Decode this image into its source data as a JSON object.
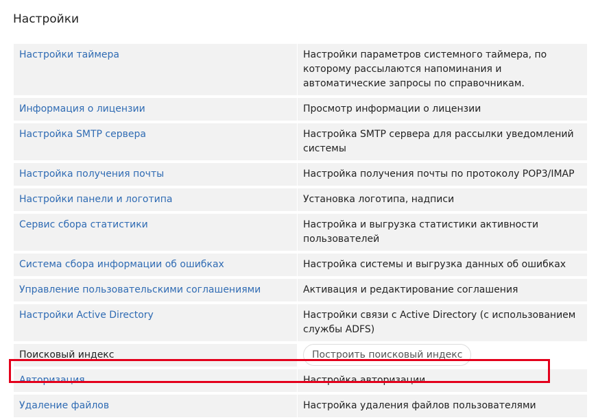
{
  "page": {
    "title": "Настройки"
  },
  "settings": [
    {
      "name": "Настройки таймера",
      "description": "Настройки параметров системного таймера, по которому рассылаются напоминания и автоматические запросы по справочникам.",
      "is_link": true
    },
    {
      "name": "Информация о лицензии",
      "description": "Просмотр информации о лицензии",
      "is_link": true
    },
    {
      "name": "Настройка SMTP сервера",
      "description": "Настройка SMTP сервера для рассылки уведомлений системы",
      "is_link": true
    },
    {
      "name": "Настройка получения почты",
      "description": "Настройка получения почты по протоколу POP3/IMAP",
      "is_link": true
    },
    {
      "name": "Настройки панели и логотипа",
      "description": "Установка логотипа, надписи",
      "is_link": true
    },
    {
      "name": "Сервис сбора статистики",
      "description": "Настройка и выгрузка статистики активности пользователей",
      "is_link": true
    },
    {
      "name": "Система сбора информации об ошибках",
      "description": "Настройка системы и выгрузка данных об ошибках",
      "is_link": true
    },
    {
      "name": "Управление пользовательскими соглашениями",
      "description": "Активация и редактирование соглашения",
      "is_link": true
    },
    {
      "name": "Настройки Active Directory",
      "description": "Настройки связи с Active Directory (с использованием службы ADFS)",
      "is_link": true
    },
    {
      "name": "Поисковый индекс",
      "button_label": "Построить поисковый индекс",
      "is_link": false
    },
    {
      "name": "Авторизация",
      "description": "Настройка авторизации",
      "is_link": true
    },
    {
      "name": "Удаление файлов",
      "description": "Настройка удаления файлов пользователями",
      "is_link": true,
      "highlighted": true
    }
  ],
  "colors": {
    "link": "#2f6bb3",
    "row_background": "#f2f2f2",
    "highlight_border": "#e3001b"
  }
}
